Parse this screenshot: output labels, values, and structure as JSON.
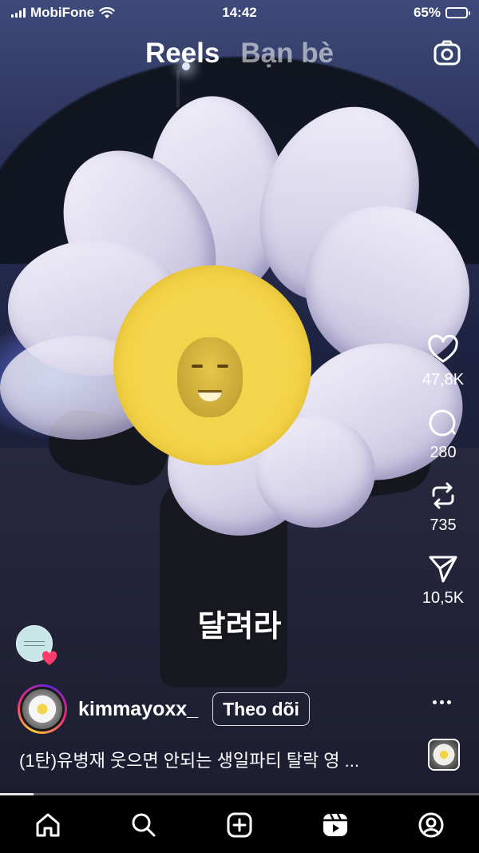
{
  "status_bar": {
    "carrier": "MobiFone",
    "time": "14:42",
    "battery": "65%",
    "battery_level": 0.65
  },
  "tabs": [
    {
      "label": "Reels",
      "active": true
    },
    {
      "label": "Bạn bè",
      "active": false
    }
  ],
  "header_icons": {
    "camera": "camera-icon"
  },
  "actions": {
    "likes": "47,8K",
    "comments": "280",
    "reposts": "735",
    "shares": "10,5K"
  },
  "overlay_caption": "달려라",
  "post": {
    "username": "kimmayoxx_",
    "follow_label": "Theo dõi",
    "description": "(1탄)유병재 웃으면 안되는 생일파티 탈락 영 ..."
  },
  "video_progress": 0.07,
  "nav": [
    "home-icon",
    "search-icon",
    "create-icon",
    "reels-icon",
    "profile-icon"
  ],
  "colors": {
    "accent_battery": "#f5d21d",
    "like_heart": "#ff3b6b"
  }
}
